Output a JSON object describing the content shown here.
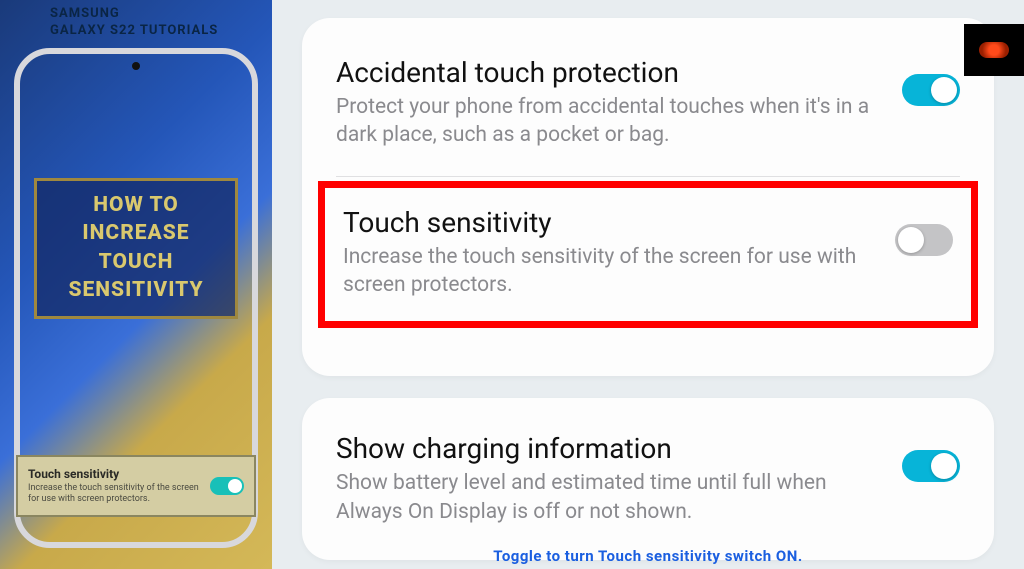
{
  "left": {
    "brand_line1": "SAMSUNG",
    "brand_line2": "GALAXY S22 TUTORIALS",
    "title_line1": "HOW TO",
    "title_line2": "INCREASE",
    "title_line3": "TOUCH",
    "title_line4": "SENSITIVITY",
    "mini_title": "Touch sensitivity",
    "mini_desc": "Increase the touch sensitivity of the screen for use with screen protectors."
  },
  "settings": {
    "accidental": {
      "title": "Accidental touch protection",
      "desc": "Protect your phone from accidental touches when it's in a dark place, such as a pocket or bag.",
      "on": true
    },
    "touch": {
      "title": "Touch sensitivity",
      "desc": "Increase the touch sensitivity of the screen for use with screen protectors.",
      "on": false
    },
    "charging": {
      "title": "Show charging information",
      "desc": "Show battery level and estimated time until full when Always On Display is off or not shown.",
      "on": true
    }
  },
  "caption": "Toggle to turn Touch sensitivity switch ON."
}
